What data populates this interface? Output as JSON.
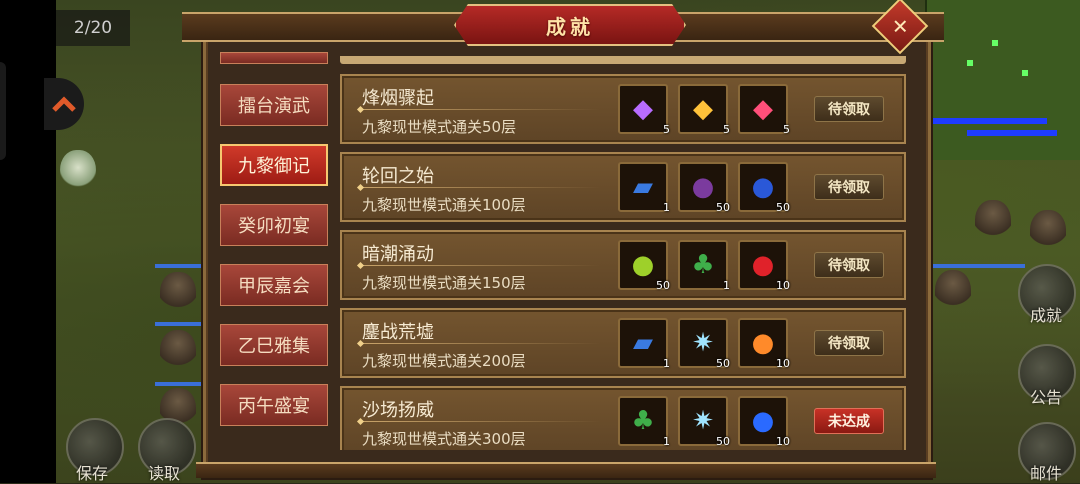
{
  "hud": {
    "stage_counter": "2/20",
    "save_label": "保存",
    "load_label": "读取",
    "right_buttons": [
      {
        "label": "成就",
        "icon": "achievement-icon"
      },
      {
        "label": "公告",
        "icon": "scroll-icon"
      },
      {
        "label": "邮件",
        "icon": "mail-icon"
      }
    ]
  },
  "dialog": {
    "title": "成就",
    "tabs": [
      {
        "label": "擂台演武",
        "active": false
      },
      {
        "label": "九黎御记",
        "active": true
      },
      {
        "label": "癸卯初宴",
        "active": false
      },
      {
        "label": "甲辰嘉会",
        "active": false
      },
      {
        "label": "乙巳雅集",
        "active": false
      },
      {
        "label": "丙午盛宴",
        "active": false
      }
    ],
    "achievements": [
      {
        "title": "烽烟骤起",
        "desc": "九黎现世模式通关50层",
        "status": "待领取",
        "status_color": "#5e4a2e",
        "rewards": [
          {
            "icon": "purple-gem-icon",
            "glyph": "◆",
            "color": "#b86cff",
            "count": "5"
          },
          {
            "icon": "gold-gem-icon",
            "glyph": "◆",
            "color": "#ffc23a",
            "count": "5"
          },
          {
            "icon": "red-gem-icon",
            "glyph": "◆",
            "color": "#ff4f7a",
            "count": "5"
          }
        ]
      },
      {
        "title": "轮回之始",
        "desc": "九黎现世模式通关100层",
        "status": "待领取",
        "status_color": "#5e4a2e",
        "rewards": [
          {
            "icon": "blue-scroll-icon",
            "glyph": "▰",
            "color": "#3a7ae0",
            "count": "1"
          },
          {
            "icon": "purple-fruit-icon",
            "glyph": "●",
            "color": "#7b3b9e",
            "count": "50"
          },
          {
            "icon": "blue-fruit-icon",
            "glyph": "●",
            "color": "#2a58d8",
            "count": "50"
          }
        ]
      },
      {
        "title": "暗潮涌动",
        "desc": "九黎现世模式通关150层",
        "status": "待领取",
        "status_color": "#5e4a2e",
        "rewards": [
          {
            "icon": "green-fruit-icon",
            "glyph": "●",
            "color": "#9ed02a",
            "count": "50"
          },
          {
            "icon": "green-tree-icon",
            "glyph": "♣",
            "color": "#3fae4a",
            "count": "1"
          },
          {
            "icon": "red-cherry-icon",
            "glyph": "●",
            "color": "#e0222a",
            "count": "10"
          }
        ]
      },
      {
        "title": "鏖战荒墟",
        "desc": "九黎现世模式通关200层",
        "status": "待领取",
        "status_color": "#5e4a2e",
        "rewards": [
          {
            "icon": "blue-scroll-icon",
            "glyph": "▰",
            "color": "#3a7ae0",
            "count": "1"
          },
          {
            "icon": "ice-crystal-icon",
            "glyph": "✷",
            "color": "#9fe4ff",
            "count": "50"
          },
          {
            "icon": "orange-cherry-icon",
            "glyph": "●",
            "color": "#ff8a2a",
            "count": "10"
          }
        ]
      },
      {
        "title": "沙场扬威",
        "desc": "九黎现世模式通关300层",
        "status": "未达成",
        "status_color": "#c83226",
        "rewards": [
          {
            "icon": "green-tree-icon",
            "glyph": "♣",
            "color": "#3fae4a",
            "count": "1"
          },
          {
            "icon": "ice-crystal-icon",
            "glyph": "✷",
            "color": "#9fe4ff",
            "count": "50"
          },
          {
            "icon": "blue-cherry-icon",
            "glyph": "●",
            "color": "#2a6aff",
            "count": "10"
          }
        ]
      }
    ]
  }
}
